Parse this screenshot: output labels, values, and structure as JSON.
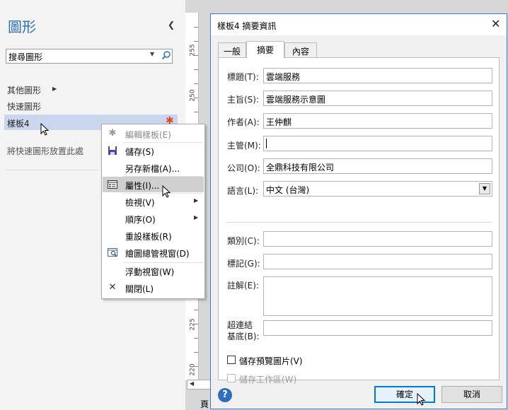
{
  "pane": {
    "title": "圖形",
    "search_value": "搜尋圖形",
    "more_shapes": "其他圖形",
    "quick_shapes": "快速圖形",
    "stencil": "樣板4",
    "drop_hint": "將快速圖形放置此處"
  },
  "ruler": {
    "labels": [
      "255",
      "250",
      "225",
      "220"
    ]
  },
  "page_tab": "頁",
  "context_menu": {
    "items": [
      {
        "label": "編輯樣板(E)",
        "icon": "star-icon",
        "disabled": true
      },
      {
        "label": "儲存(S)",
        "icon": "save-icon"
      },
      {
        "label": "另存新檔(A)...",
        "icon": ""
      },
      {
        "label": "屬性(I)...",
        "icon": "properties-icon",
        "hover": true
      },
      {
        "label": "檢視(V)",
        "icon": "",
        "submenu": true
      },
      {
        "label": "順序(O)",
        "icon": "",
        "submenu": true
      },
      {
        "label": "重設樣板(R)",
        "icon": ""
      },
      {
        "label": "繪圖總管視窗(D)",
        "icon": "drawing-explorer-icon"
      },
      {
        "label": "浮動視窗(W)",
        "icon": ""
      },
      {
        "label": "關閉(L)",
        "icon": "close-x-icon"
      }
    ]
  },
  "dialog": {
    "title": "樣板4 摘要資訊",
    "tabs": [
      "一般",
      "摘要",
      "內容"
    ],
    "active_tab": "摘要",
    "fields": {
      "title_label": "標題(T):",
      "title_value": "雲端服務",
      "subject_label": "主旨(S):",
      "subject_value": "雲端服務示意圖",
      "author_label": "作者(A):",
      "author_value": "王仲麒",
      "manager_label": "主管(M):",
      "manager_value": "",
      "company_label": "公司(O):",
      "company_value": "全鼎科技有限公司",
      "language_label": "語言(L):",
      "language_value": "中文 (台灣)",
      "category_label": "類別(C):",
      "category_value": "",
      "tags_label": "標記(G):",
      "tags_value": "",
      "comments_label": "註解(E):",
      "comments_value": "",
      "hyperlink_label_1": "超連結",
      "hyperlink_label_2": "基底(B):",
      "hyperlink_value": ""
    },
    "save_preview": "儲存預覽圖片(V)",
    "save_workspace": "儲存工作區(W)",
    "ok": "確定",
    "cancel": "取消",
    "help": "?"
  },
  "colors": {
    "accent": "#2e6fb0",
    "selection": "#cad6ee",
    "dialog_border": "#3a7bd5"
  }
}
